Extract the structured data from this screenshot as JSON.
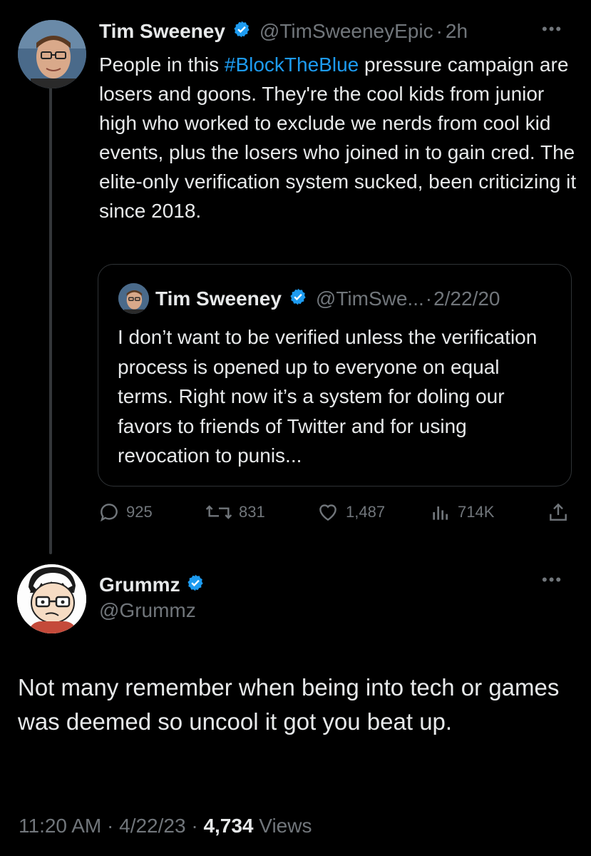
{
  "main_tweet": {
    "author_name": "Tim Sweeney",
    "handle": "@TimSweeneyEpic",
    "separator": "·",
    "time_ago": "2h",
    "text_before": "People in this ",
    "hashtag": "#BlockTheBlue",
    "text_after": " pressure campaign are losers and goons. They're the cool kids from junior high who worked to exclude we nerds from cool kid events, plus the losers who joined in to gain cred. The elite-only verification system sucked, been criticizing it since 2018.",
    "more_label": "•••",
    "quoted": {
      "author_name": "Tim Sweeney",
      "handle": "@TimSwe...",
      "separator": "·",
      "date": "2/22/20",
      "text": "I don’t want to be verified unless the verification process is opened up to everyone on equal terms. Right now it’s a system for doling our favors to friends of Twitter and for using revocation to punis..."
    },
    "actions": {
      "replies": "925",
      "retweets": "831",
      "likes": "1,487",
      "views": "714K"
    }
  },
  "reply_tweet": {
    "author_name": "Grummz",
    "handle": "@Grummz",
    "more_label": "•••",
    "text": "Not many remember when being into tech or games was deemed so uncool it got you beat up.",
    "time": "11:20 AM",
    "sep1": "·",
    "date": "4/22/23",
    "sep2": "·",
    "views_count": "4,734",
    "views_label": " Views"
  },
  "colors": {
    "background": "#000000",
    "text": "#e7e9ea",
    "muted": "#71767b",
    "accent": "#1d9bf0"
  },
  "icons": [
    "verified-badge-icon",
    "reply-icon",
    "retweet-icon",
    "like-icon",
    "views-icon",
    "share-icon",
    "more-icon"
  ]
}
